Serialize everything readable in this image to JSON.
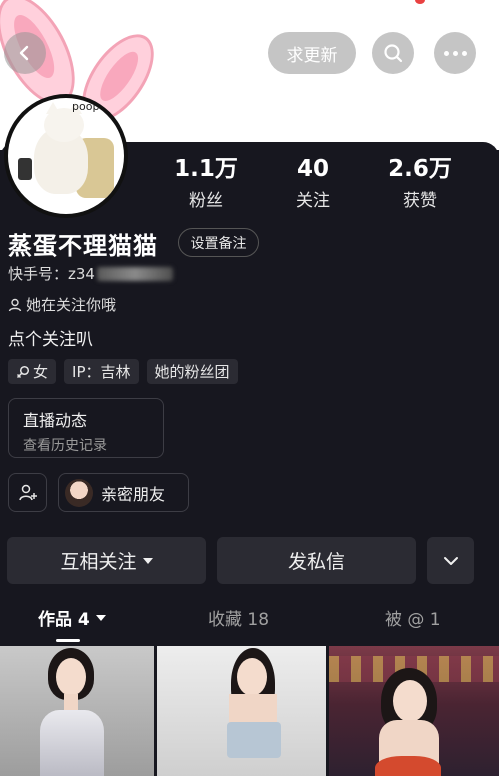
{
  "header": {
    "update_request_label": "求更新",
    "icons": [
      "back-icon",
      "search-icon",
      "more-icon"
    ]
  },
  "avatar": {
    "sticker_text": "poop"
  },
  "stats": [
    {
      "value": "1.1万",
      "label": "粉丝"
    },
    {
      "value": "40",
      "label": "关注"
    },
    {
      "value": "2.6万",
      "label": "获赞"
    }
  ],
  "profile": {
    "nickname": "蒸蛋不理猫猫",
    "remark_button": "设置备注",
    "uid_prefix": "快手号：z34",
    "follows_you": "她在关注你哦",
    "bio": "点个关注叭",
    "tags": [
      {
        "label": "女",
        "icon": "female-icon"
      },
      {
        "label": "IP：吉林"
      },
      {
        "label": "她的粉丝团"
      }
    ]
  },
  "live": {
    "title": "直播动态",
    "subtitle": "查看历史记录"
  },
  "close_friends": {
    "label": "亲密朋友"
  },
  "actions": {
    "mutual_follow": "互相关注",
    "message": "发私信"
  },
  "tabs": [
    {
      "label": "作品 4",
      "active": true
    },
    {
      "label": "收藏 18",
      "active": false
    },
    {
      "label": "被 @ 1",
      "active": false
    }
  ],
  "colors": {
    "background": "#17171f",
    "button": "#2b2b33",
    "text": "#ffffff",
    "muted": "#a0a0a0"
  }
}
